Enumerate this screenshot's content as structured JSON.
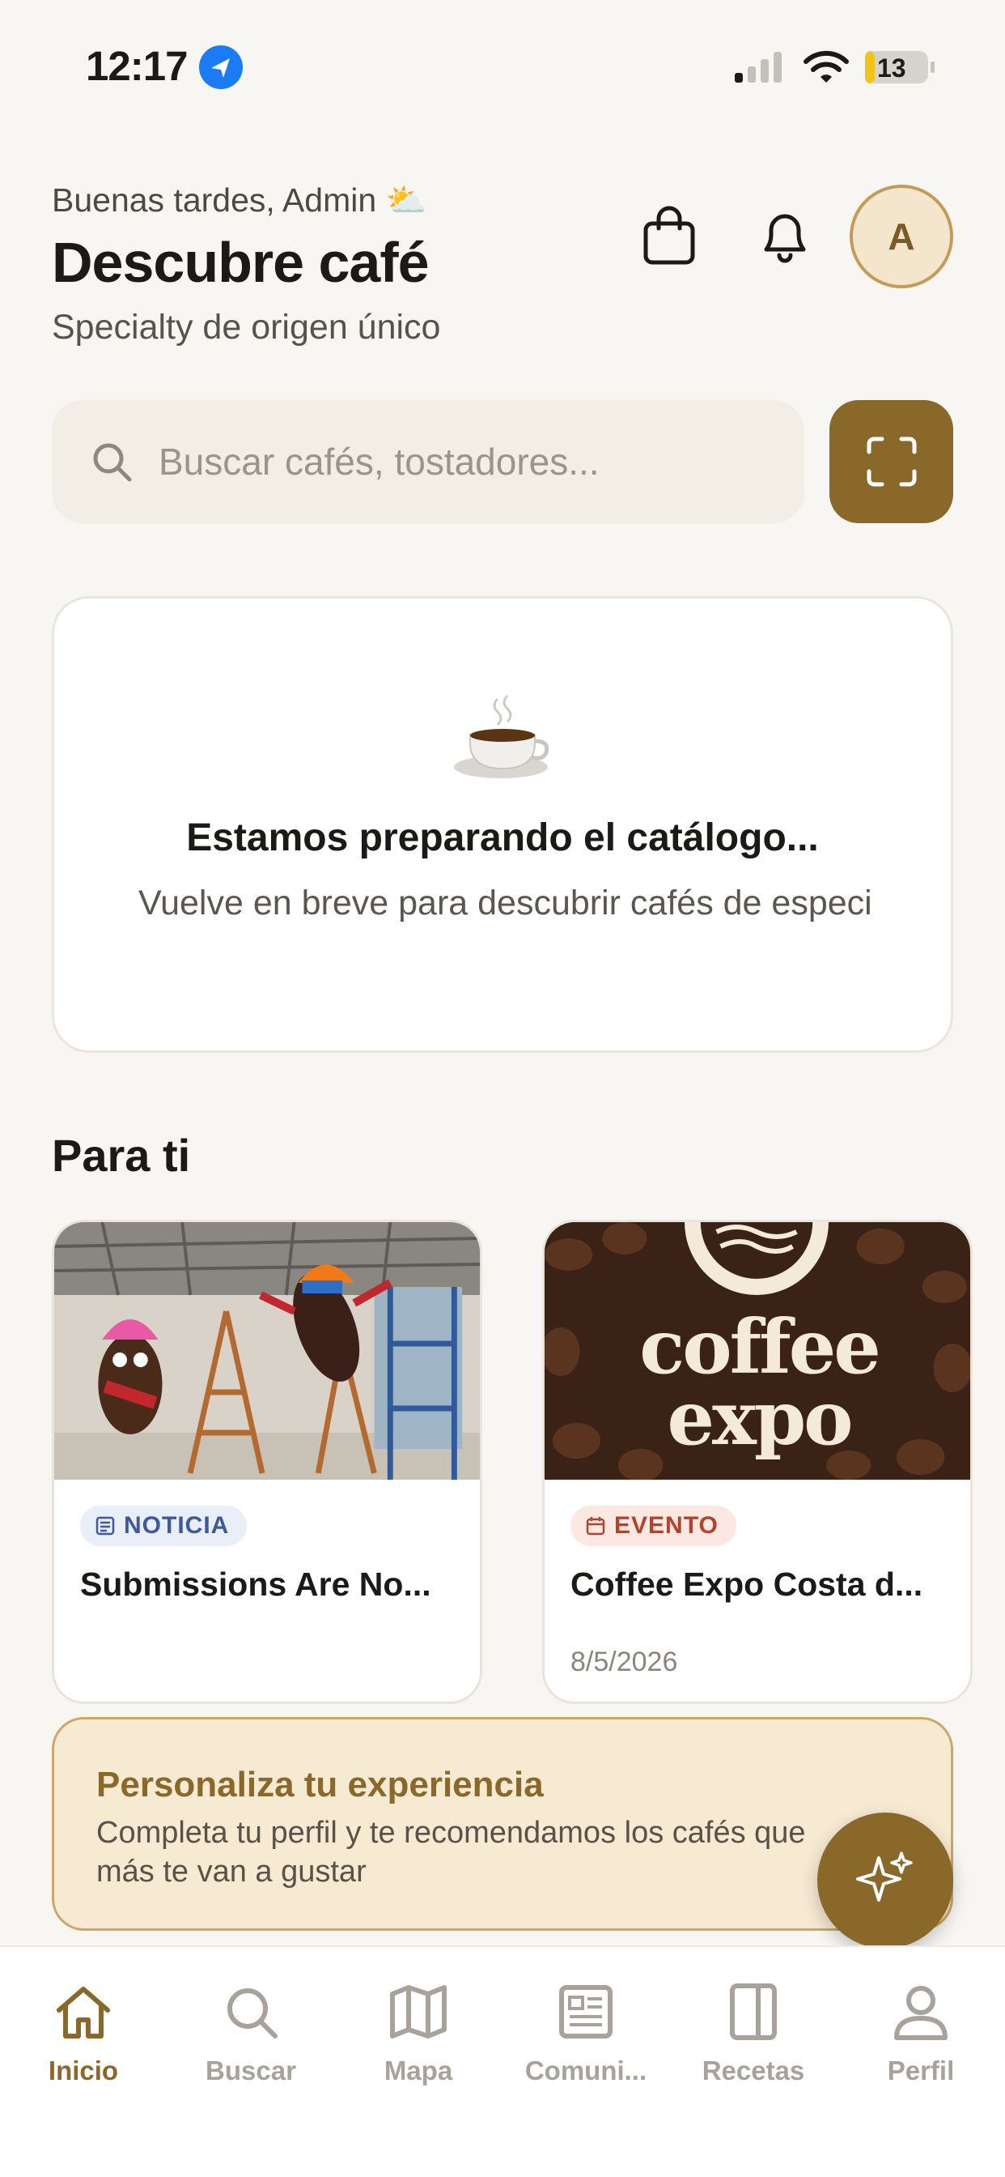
{
  "status_bar": {
    "time": "12:17",
    "battery": "13"
  },
  "header": {
    "greeting": "Buenas tardes, Admin ⛅",
    "title": "Descubre café",
    "subtitle": "Specialty de origen único",
    "avatar_initial": "A"
  },
  "search": {
    "placeholder": "Buscar cafés, tostadores..."
  },
  "empty_catalog": {
    "icon": "☕",
    "title": "Estamos preparando el catálogo...",
    "text": "Vuelve en breve para descubrir cafés de especialidad"
  },
  "for_you": {
    "title": "Para ti",
    "cards": [
      {
        "badge": "NOTICIA",
        "title": "Submissions Are No...",
        "date": ""
      },
      {
        "badge": "EVENTO",
        "title": "Coffee Expo Costa d...",
        "date": "8/5/2026",
        "image_text": "coffee expo"
      }
    ]
  },
  "banner": {
    "title": "Personaliza tu experiencia",
    "text": "Completa tu perfil y te recomendamos los cafés que más te van a gustar"
  },
  "nav": {
    "items": [
      {
        "label": "Inicio",
        "icon": "home-icon",
        "active": true
      },
      {
        "label": "Buscar",
        "icon": "search-icon"
      },
      {
        "label": "Mapa",
        "icon": "map-icon"
      },
      {
        "label": "Comuni...",
        "icon": "newspaper-icon"
      },
      {
        "label": "Recetas",
        "icon": "book-icon"
      },
      {
        "label": "Perfil",
        "icon": "user-icon"
      }
    ]
  },
  "colors": {
    "accent": "#8a6829",
    "background": "#f8f6f2",
    "nav_inactive": "#a8a29a"
  }
}
